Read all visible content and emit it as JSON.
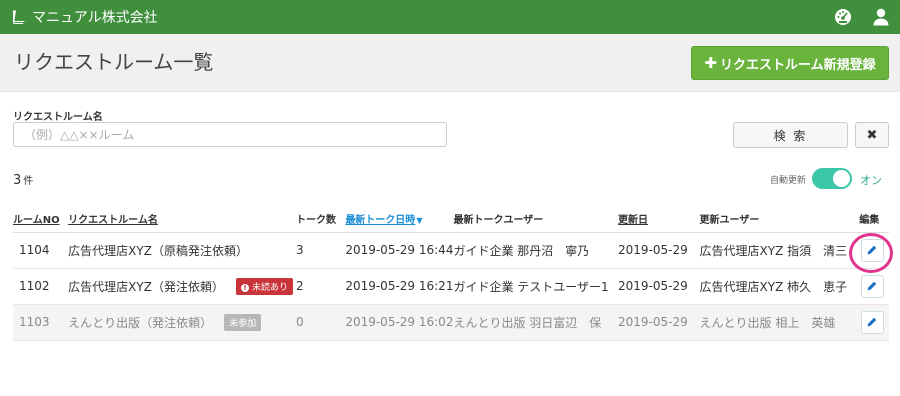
{
  "app": {
    "title": "マニュアル株式会社",
    "icons": {
      "brand": "book-icon",
      "dashboard": "dashboard-icon",
      "user": "user-icon"
    }
  },
  "header": {
    "title": "リクエストルーム一覧",
    "new_button_label": "リクエストルーム新規登録"
  },
  "search": {
    "label": "リクエストルーム名",
    "placeholder": "（例）△△××ルーム",
    "value": "",
    "search_label": "検 索",
    "clear_label": "✖"
  },
  "list": {
    "count": "3",
    "count_unit": "件",
    "auto_update_label": "自動更新",
    "auto_update_state": "オン"
  },
  "table": {
    "columns": {
      "room_no": "ルームNO",
      "room_name": "リクエストルーム名",
      "talk_count": "トーク数",
      "last_talk": "最新トーク日時",
      "last_user": "最新トークユーザー",
      "updated": "更新日",
      "updated_user": "更新ユーザー",
      "edit": "編集"
    },
    "rows": [
      {
        "room_no": "1104",
        "room_name": "広告代理店XYZ（原稿発注依頼）",
        "badge": "",
        "talk_count": "3",
        "last_talk": "2019-05-29 16:44",
        "last_user": "ガイド企業 那丹沼　寧乃",
        "updated": "2019-05-29",
        "updated_user": "広告代理店XYZ 指須　清三"
      },
      {
        "room_no": "1102",
        "room_name": "広告代理店XYZ（発注依頼）",
        "badge": "未読あり",
        "talk_count": "2",
        "last_talk": "2019-05-29 16:21",
        "last_user": "ガイド企業 テストユーザー1",
        "updated": "2019-05-29",
        "updated_user": "広告代理店XYZ 柿久　恵子"
      },
      {
        "room_no": "1103",
        "room_name": "えんとり出版（発注依頼）",
        "badge": "未参加",
        "talk_count": "0",
        "last_talk": "2019-05-29 16:02",
        "last_user": "えんとり出版 羽日富辺　保",
        "updated": "2019-05-29",
        "updated_user": "えんとり出版 相上　英雄"
      }
    ]
  },
  "colors": {
    "navbar": "#3f8f3c",
    "new_button": "#6ab43e",
    "toggle": "#3cc8a8",
    "unread_badge": "#c9333a",
    "sort_link": "#1a8fd8",
    "highlight": "#e2338e"
  }
}
